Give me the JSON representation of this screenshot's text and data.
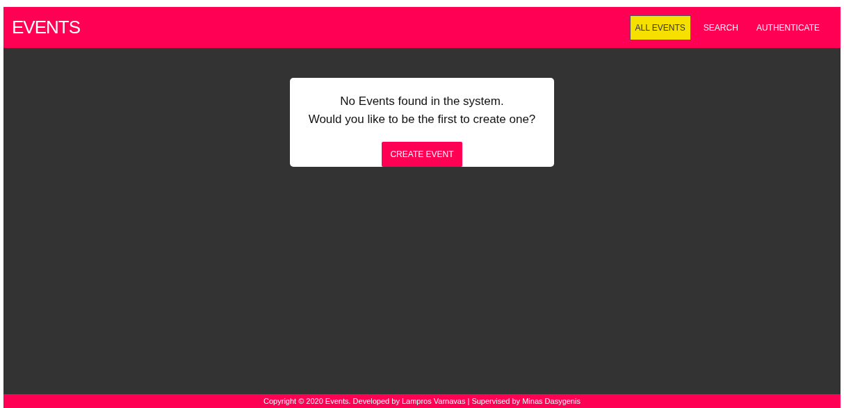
{
  "header": {
    "logo": "EVENTS",
    "nav": [
      {
        "label": "ALL EVENTS",
        "selected": true
      },
      {
        "label": "SEARCH",
        "selected": false
      },
      {
        "label": "AUTHENTICATE",
        "selected": false
      }
    ]
  },
  "notice": {
    "lines": [
      "No Events found in the system.",
      "Would you like to be the first to create one?"
    ],
    "button": "CREATE EVENT"
  },
  "footer": {
    "text": "Copyright © 2020 Events. Developed by Lampros Varnavas | Supervised by Minas Dasygenis"
  }
}
